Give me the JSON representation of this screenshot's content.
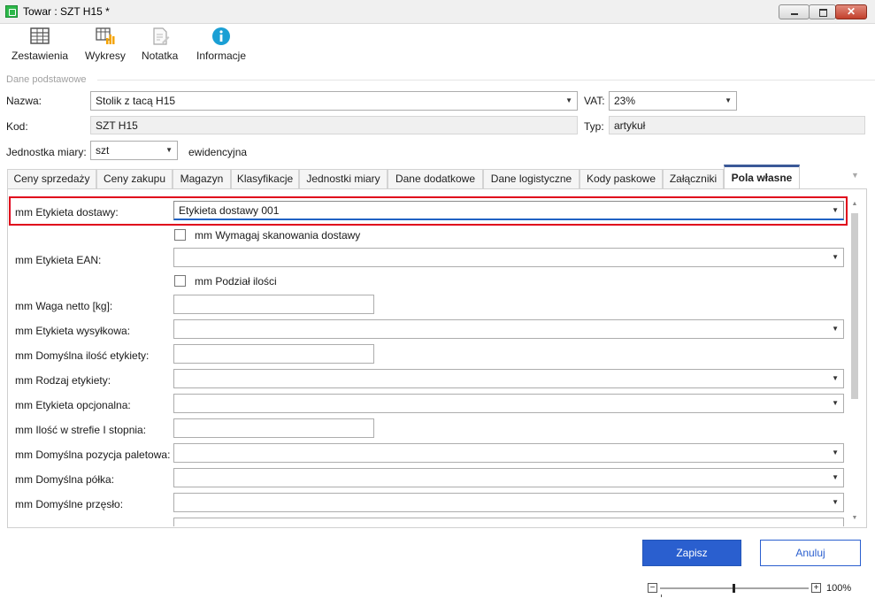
{
  "window": {
    "title": "Towar : SZT H15 *"
  },
  "toolbar": {
    "items": [
      {
        "label": "Zestawienia",
        "icon": "table-icon"
      },
      {
        "label": "Wykresy",
        "icon": "chart-icon"
      },
      {
        "label": "Notatka",
        "icon": "note-icon"
      },
      {
        "label": "Informacje",
        "icon": "info-icon"
      }
    ]
  },
  "basic": {
    "section_label": "Dane podstawowe",
    "nazwa_label": "Nazwa:",
    "nazwa_value": "Stolik z tacą H15",
    "vat_label": "VAT:",
    "vat_value": "23%",
    "kod_label": "Kod:",
    "kod_value": "SZT H15",
    "typ_label": "Typ:",
    "typ_value": "artykuł",
    "jm_label": "Jednostka miary:",
    "jm_value": "szt",
    "jm_note": "ewidencyjna"
  },
  "tabs": [
    {
      "label": "Ceny sprzedaży"
    },
    {
      "label": "Ceny zakupu"
    },
    {
      "label": "Magazyn"
    },
    {
      "label": "Klasyfikacje"
    },
    {
      "label": "Jednostki miary"
    },
    {
      "label": "Dane dodatkowe"
    },
    {
      "label": "Dane logistyczne"
    },
    {
      "label": "Kody paskowe"
    },
    {
      "label": "Załączniki"
    },
    {
      "label": "Pola własne"
    }
  ],
  "active_tab": "Pola własne",
  "fields": {
    "etykieta_dostawy_label": "mm Etykieta dostawy:",
    "etykieta_dostawy_value": "Etykieta dostawy 001",
    "wymagaj_skan_label": "mm Wymagaj skanowania dostawy",
    "etykieta_ean_label": "mm Etykieta EAN:",
    "podzial_ilosci_label": "mm Podział ilości",
    "waga_netto_label": "mm Waga netto [kg]:",
    "etykieta_wysylkowa_label": "mm Etykieta wysyłkowa:",
    "domyslna_ilosc_label": "mm Domyślna ilość etykiety:",
    "rodzaj_etykiety_label": "mm Rodzaj etykiety:",
    "etykieta_opcjonalna_label": "mm Etykieta opcjonalna:",
    "ilosc_strefie_label": "mm Ilość w strefie I stopnia:",
    "domyslna_pozycja_label": "mm Domyślna pozycja paletowa:",
    "domyslna_polka_label": "mm Domyślna półka:",
    "domyslne_przeslo_label": "mm Domyślne przęsło:"
  },
  "footer": {
    "save_label": "Zapisz",
    "cancel_label": "Anuluj",
    "zoom_minus": "−",
    "zoom_plus": "+",
    "zoom_level": "100%"
  },
  "colors": {
    "primary": "#2a5fcf",
    "highlight": "#e0001b",
    "active_tab_border": "#3b5998"
  }
}
